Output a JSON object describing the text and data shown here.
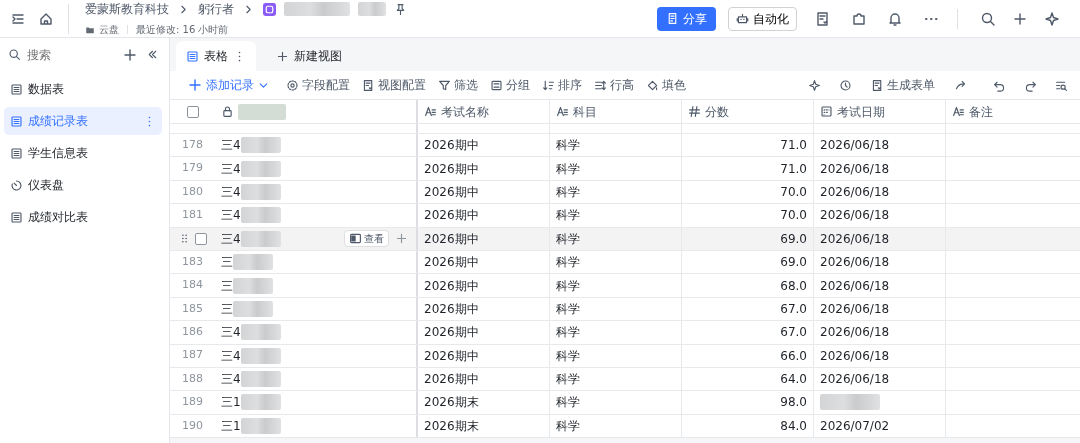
{
  "breadcrumb": {
    "items": [
      "爱蒙斯教育科技",
      "躬行者"
    ],
    "location": "云盘",
    "modified": "最近修改: 16 小时前"
  },
  "header_buttons": {
    "share": "分享",
    "automation": "自动化"
  },
  "sidebar": {
    "search_placeholder": "搜索",
    "items": [
      {
        "label": "数据表",
        "kind": "table",
        "selected": false
      },
      {
        "label": "成绩记录表",
        "kind": "table",
        "selected": true
      },
      {
        "label": "学生信息表",
        "kind": "table",
        "selected": false
      },
      {
        "label": "仪表盘",
        "kind": "dashboard",
        "selected": false
      },
      {
        "label": "成绩对比表",
        "kind": "table",
        "selected": false
      }
    ]
  },
  "view_tabs": [
    {
      "label": "表格",
      "selected": true
    }
  ],
  "new_view": "新建视图",
  "toolbar": {
    "add_record": "添加记录",
    "items": [
      "字段配置",
      "视图配置",
      "筛选",
      "分组",
      "排序",
      "行高",
      "填色"
    ],
    "form": "生成表单"
  },
  "table": {
    "columns": [
      {
        "label": "考试名称",
        "kind": "text"
      },
      {
        "label": "科目",
        "kind": "text"
      },
      {
        "label": "分数",
        "kind": "number"
      },
      {
        "label": "考试日期",
        "kind": "date"
      },
      {
        "label": "备注",
        "kind": "text"
      }
    ],
    "view_label": "查看",
    "select_all_checked": false,
    "rows": [
      {
        "number": "178",
        "name": "三4",
        "exam": "2026期中",
        "subject": "科学",
        "score": "71.0",
        "date": "2026/06/18",
        "hovered": false
      },
      {
        "number": "179",
        "name": "三4",
        "exam": "2026期中",
        "subject": "科学",
        "score": "71.0",
        "date": "2026/06/18",
        "hovered": false
      },
      {
        "number": "180",
        "name": "三4",
        "exam": "2026期中",
        "subject": "科学",
        "score": "70.0",
        "date": "2026/06/18",
        "hovered": false
      },
      {
        "number": "181",
        "name": "三4",
        "exam": "2026期中",
        "subject": "科学",
        "score": "70.0",
        "date": "2026/06/18",
        "hovered": false
      },
      {
        "name": "三4",
        "checked": false,
        "exam": "2026期中",
        "subject": "科学",
        "score": "69.0",
        "date": "2026/06/18",
        "hovered": true
      },
      {
        "number": "183",
        "name": "三",
        "exam": "2026期中",
        "subject": "科学",
        "score": "69.0",
        "date": "2026/06/18",
        "hovered": false
      },
      {
        "number": "184",
        "name": "三",
        "exam": "2026期中",
        "subject": "科学",
        "score": "68.0",
        "date": "2026/06/18",
        "hovered": false
      },
      {
        "number": "185",
        "name": "三",
        "exam": "2026期中",
        "subject": "科学",
        "score": "67.0",
        "date": "2026/06/18",
        "hovered": false
      },
      {
        "number": "186",
        "name": "三4",
        "exam": "2026期中",
        "subject": "科学",
        "score": "67.0",
        "date": "2026/06/18",
        "hovered": false
      },
      {
        "number": "187",
        "name": "三4",
        "exam": "2026期中",
        "subject": "科学",
        "score": "66.0",
        "date": "2026/06/18",
        "hovered": false
      },
      {
        "number": "188",
        "name": "三4",
        "exam": "2026期中",
        "subject": "科学",
        "score": "64.0",
        "date": "2026/06/18",
        "hovered": false
      },
      {
        "number": "189",
        "name": "三1",
        "exam": "2026期末",
        "subject": "科学",
        "score": "98.0",
        "hovered": false
      },
      {
        "number": "190",
        "name": "三1",
        "exam": "2026期末",
        "subject": "科学",
        "score": "84.0",
        "date": "2026/07/02",
        "hovered": false
      }
    ]
  }
}
